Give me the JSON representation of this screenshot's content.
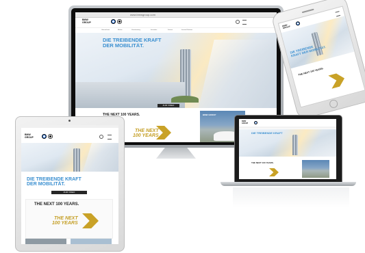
{
  "brand": {
    "wordmark_line1": "BMW",
    "wordmark_line2": "GROUP"
  },
  "desktop": {
    "url": "www.bmwgroup.com",
    "nav": [
      "Unternehmen",
      "Marken",
      "Verantwortung",
      "Innovation",
      "Karriere",
      "Investor Relations"
    ],
    "headline_line1": "DIE TREIBENDE KRAFT",
    "headline_line2": "DER MOBILITÄT.",
    "cta": "ZUM VIDEO",
    "next_title": "THE NEXT 100 YEARS.",
    "gold_line1": "THE NEXT",
    "gold_line2": "100 YEARS",
    "thumb_label": "BMW GROUP"
  },
  "tablet": {
    "headline_line1": "DIE TREIBENDE KRAFT",
    "headline_line2": "DER MOBILITÄT.",
    "cta": "ZUM VIDEO",
    "next_title": "THE NEXT 100 YEARS.",
    "gold_line1": "THE NEXT",
    "gold_line2": "100 YEARS"
  },
  "laptop": {
    "headline": "DIE TREIBENDE KRAFT",
    "next_title": "THE NEXT 100 YEARS."
  },
  "phone": {
    "headline_line1": "DIE TREIBENDE",
    "headline_line2": "KRAFT DER MOBILITÄT.",
    "next_title": "THE NEXT 100 YEARS."
  },
  "colors": {
    "accent_blue": "#3a8fd0",
    "gold": "#c9a227",
    "cta_bg": "#262626"
  }
}
